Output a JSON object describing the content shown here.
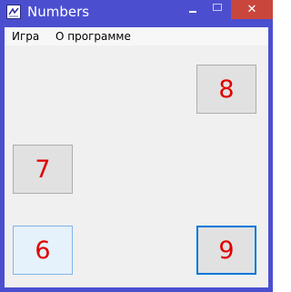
{
  "window": {
    "title": "Numbers",
    "close_label": "✕"
  },
  "menu": {
    "items": [
      {
        "label": "Игра"
      },
      {
        "label": "О программе"
      }
    ]
  },
  "buttons": [
    {
      "label": "8"
    },
    {
      "label": "7"
    },
    {
      "label": "6"
    },
    {
      "label": "9"
    }
  ],
  "colors": {
    "titlebar": "#4b4fcf",
    "close": "#c9463d",
    "number_text": "#e00000",
    "client_bg": "#f0f0f0"
  },
  "icons": [
    "app-icon",
    "minimize-icon",
    "maximize-icon",
    "close-icon"
  ]
}
